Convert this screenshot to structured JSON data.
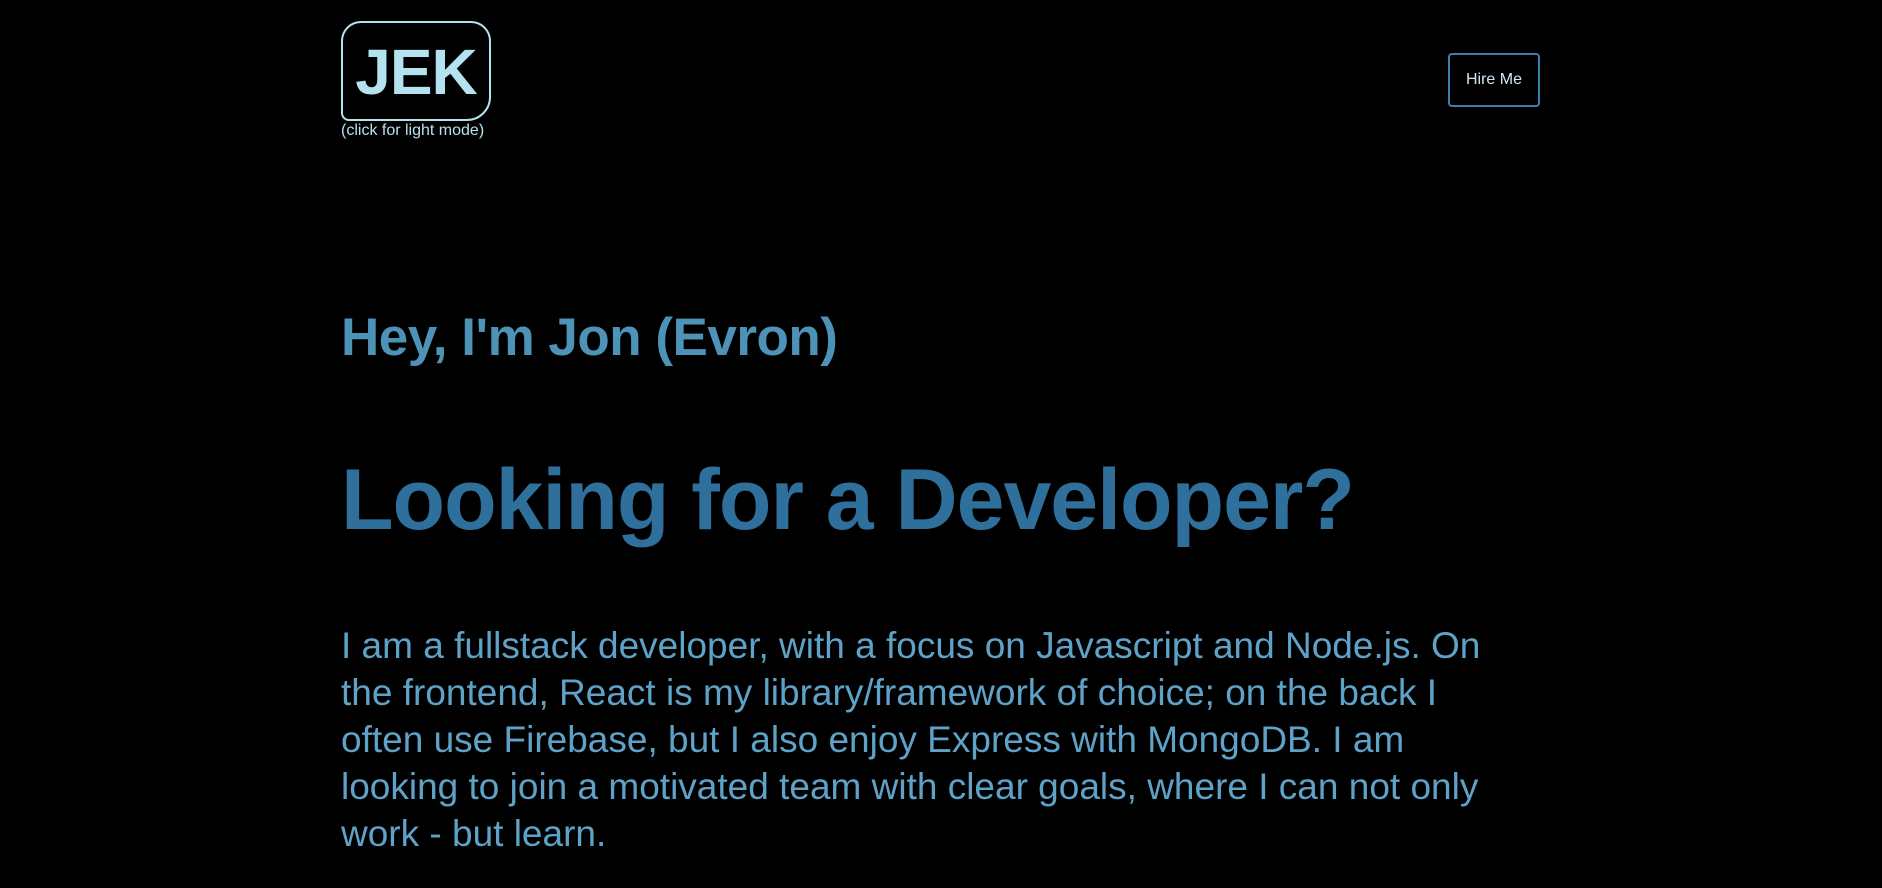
{
  "header": {
    "logo_text": "JEK",
    "logo_hint": "(click for light mode)",
    "hire_button_label": "Hire Me"
  },
  "hero": {
    "intro": "Hey, I'm Jon (Evron)",
    "headline": "Looking for a Developer?",
    "bio": "I am a fullstack developer, with a focus on Javascript and Node.js. On the frontend, React is my library/framework of choice; on the back I often use Firebase, but I also enjoy Express with MongoDB. I am looking to join a motivated team with clear goals, where I can not only work - but learn."
  },
  "colors": {
    "background": "#000000",
    "logo": "#b5e2ef",
    "button_border": "#3c7fad",
    "intro": "#4d93b8",
    "headline": "#2f6f9b",
    "bio": "#5ea2c8"
  }
}
